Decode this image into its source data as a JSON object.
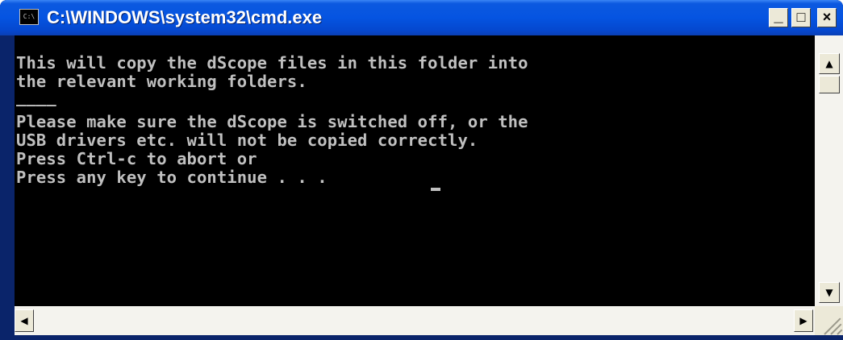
{
  "window": {
    "title": "C:\\WINDOWS\\system32\\cmd.exe",
    "icon_label": "C:\\",
    "icon_name": "cmd-icon",
    "title_bar_color": "#0554e1"
  },
  "controls": {
    "minimize_label": "_",
    "maximize_label": "□",
    "close_label": "×"
  },
  "console": {
    "background": "#000000",
    "foreground": "#c0c0c0",
    "lines": [
      "This will copy the dScope files in this folder into",
      "the relevant working folders.",
      "____",
      "Please make sure the dScope is switched off, or the",
      "USB drivers etc. will not be copied correctly.",
      "Press Ctrl-c to abort or",
      "Press any key to continue . . . "
    ]
  },
  "scrollbars": {
    "up_arrow": "▲",
    "down_arrow": "▼",
    "left_arrow": "◀",
    "right_arrow": "▶"
  }
}
